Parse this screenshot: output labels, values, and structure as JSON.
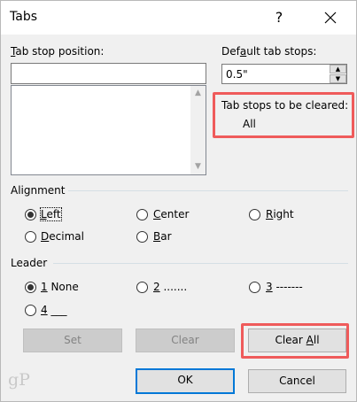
{
  "window": {
    "title": "Tabs",
    "help_glyph": "?",
    "close_glyph": "close"
  },
  "tab_stop_position": {
    "label_prefix": "",
    "label_mnemonic": "T",
    "label_rest": "ab stop position:",
    "value": "",
    "list_items": []
  },
  "default_tab_stops": {
    "label_prefix": "Def",
    "label_mnemonic": "a",
    "label_rest": "ult tab stops:",
    "value": "0.5\""
  },
  "tab_stops_to_be_cleared": {
    "label": "Tab stops to be cleared:",
    "value": "All"
  },
  "alignment": {
    "label": "Alignment",
    "options": [
      {
        "mnemonic": "L",
        "rest": "eft",
        "checked": true
      },
      {
        "mnemonic": "C",
        "rest": "enter",
        "checked": false
      },
      {
        "mnemonic": "R",
        "rest": "ight",
        "checked": false
      },
      {
        "mnemonic": "D",
        "rest": "ecimal",
        "checked": false
      },
      {
        "mnemonic": "B",
        "rest": "ar",
        "checked": false
      }
    ]
  },
  "leader": {
    "label": "Leader",
    "options": [
      {
        "mnemonic": "1",
        "rest": " None",
        "checked": true
      },
      {
        "mnemonic": "2",
        "rest": " .......",
        "checked": false
      },
      {
        "mnemonic": "3",
        "rest": " -------",
        "checked": false
      },
      {
        "mnemonic": "4",
        "rest": " ___",
        "checked": false
      }
    ]
  },
  "buttons": {
    "set": {
      "label": "Set",
      "disabled": true
    },
    "clear": {
      "label": "Clear",
      "disabled": true
    },
    "clear_all_prefix": "Clear ",
    "clear_all_mnemonic": "A",
    "clear_all_rest": "ll",
    "ok": "OK",
    "cancel": "Cancel"
  },
  "watermark": "gP",
  "colors": {
    "highlight": "#ef5b5b",
    "default_button_border": "#0078d7",
    "dialog_bg": "#f0f0f0"
  }
}
